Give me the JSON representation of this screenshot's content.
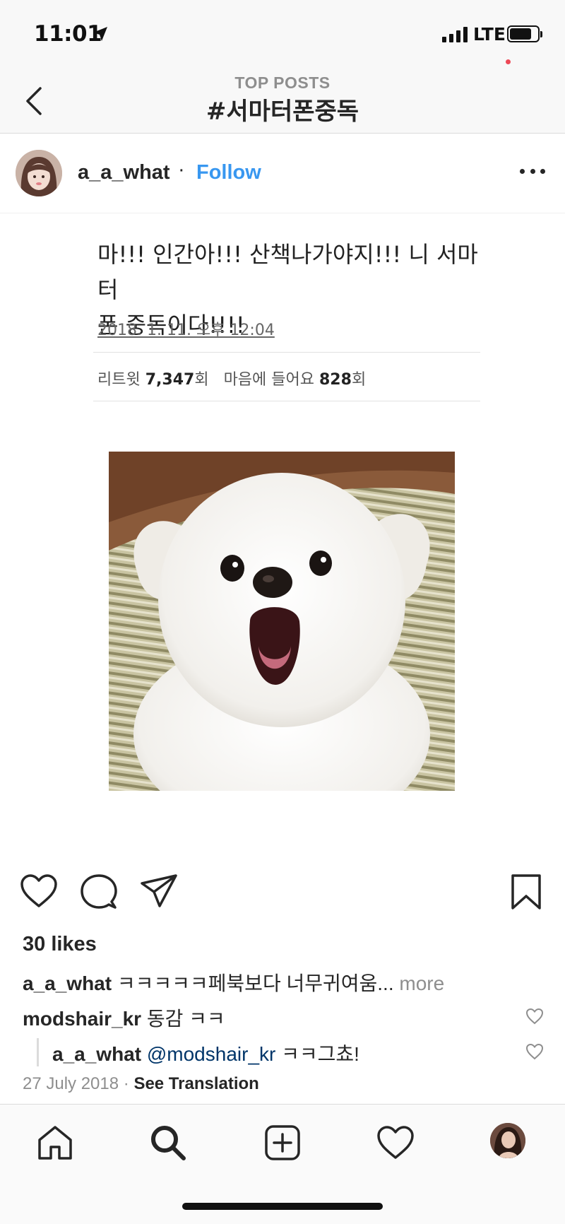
{
  "status_bar": {
    "time": "11:01",
    "network": "LTE",
    "battery_level": 0.8
  },
  "nav": {
    "subtitle": "TOP POSTS",
    "title": "#서마터폰중독"
  },
  "post": {
    "username": "a_a_what",
    "separator": "·",
    "follow_label": "Follow",
    "tweet": {
      "line1": "마!!! 인간아!!! 산책나가야지!!! 니 서마터",
      "line2": "폰 중독이다!!!!",
      "timestamp": "2018. 1. 11. 오후 12:04",
      "retweet_label": "리트윗",
      "retweet_count": "7,347",
      "retweet_unit": "회",
      "like_label": "마음에 들어요",
      "like_count": "828",
      "like_unit": "회"
    },
    "likes": "30 likes",
    "caption": {
      "user": "a_a_what",
      "text": " ㅋㅋㅋㅋㅋ페북보다 너무귀여움...",
      "more": " more"
    },
    "comments": [
      {
        "user": "modshair_kr",
        "text": " 동감 ㅋㅋ"
      },
      {
        "user": "a_a_what",
        "mention": " @modshair_kr",
        "text": " ㅋㅋ그쵸!"
      }
    ],
    "date": "27 July 2018",
    "date_separator": " · ",
    "see_translation": "See Translation"
  },
  "icons": {
    "back": "chevron-left-icon",
    "like": "heart-icon",
    "comment": "comment-bubble-icon",
    "share": "paper-plane-icon",
    "save": "bookmark-icon",
    "tab_home": "home-icon",
    "tab_search": "search-icon",
    "tab_add": "add-post-icon",
    "tab_activity": "heart-icon",
    "tab_profile": "profile-avatar"
  },
  "colors": {
    "link": "#3897f0",
    "mention": "#003569",
    "muted": "#8e8e8e",
    "notification": "#ed4956"
  }
}
